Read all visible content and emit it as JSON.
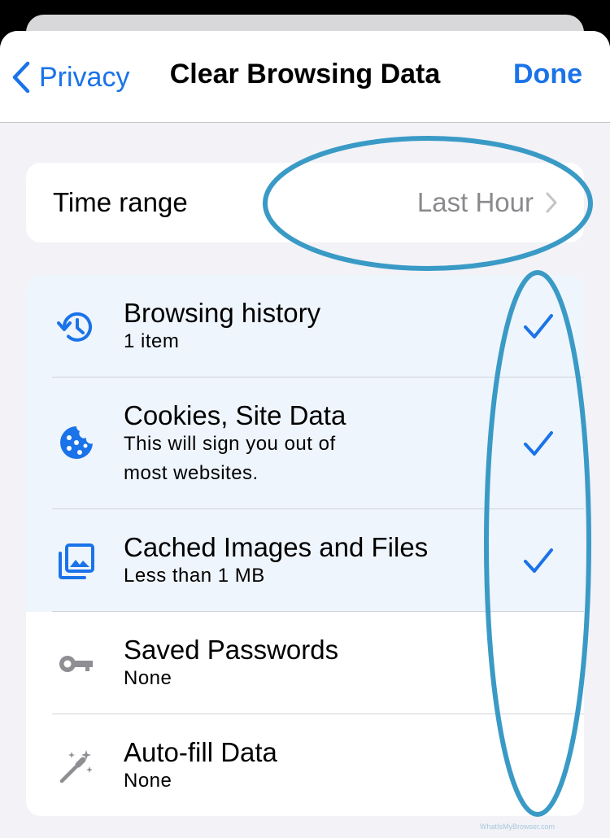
{
  "nav": {
    "back_label": "Privacy",
    "title": "Clear Browsing Data",
    "done_label": "Done"
  },
  "time_range": {
    "label": "Time range",
    "value": "Last Hour"
  },
  "data_types": [
    {
      "label": "Browsing history",
      "detail": "1 item",
      "checked": true,
      "icon": "history-icon"
    },
    {
      "label": "Cookies, Site Data",
      "detail_line1": "This will sign you out of",
      "detail_line2": "most websites.",
      "checked": true,
      "icon": "cookie-icon"
    },
    {
      "label": "Cached Images and Files",
      "detail": "Less than 1 MB",
      "checked": true,
      "icon": "images-icon"
    },
    {
      "label": "Saved Passwords",
      "detail": "None",
      "checked": false,
      "icon": "key-icon"
    },
    {
      "label": "Auto-fill Data",
      "detail": "None",
      "checked": false,
      "icon": "magic-wand-icon"
    }
  ],
  "watermark": "WhatIsMyBrowser.com",
  "colors": {
    "accent": "#1a73e8",
    "annotation": "#3a9ac6",
    "selected_row": "#eff5fc",
    "secondary_text": "#8a8a8e",
    "grey_icon": "#8e8e93"
  }
}
